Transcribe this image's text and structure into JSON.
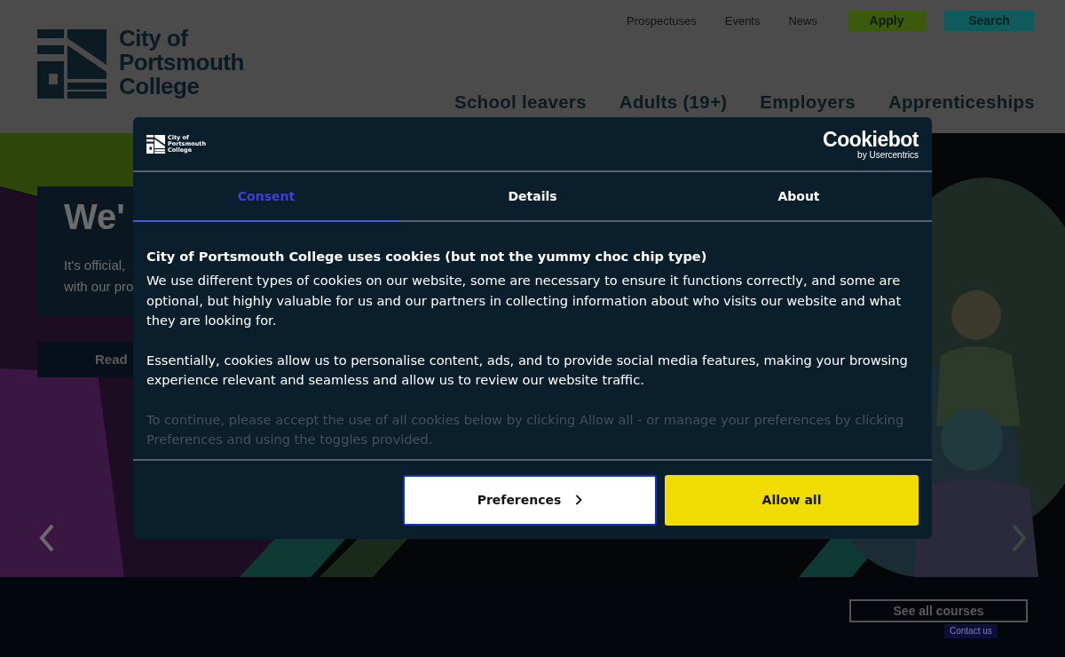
{
  "header": {
    "logo_lines": [
      "City of",
      "Portsmouth",
      "College"
    ],
    "utility_links": [
      {
        "label": "Prospectuses",
        "kind": "link"
      },
      {
        "label": "Events",
        "kind": "link"
      },
      {
        "label": "News",
        "kind": "link"
      },
      {
        "label": "Apply",
        "kind": "apply"
      },
      {
        "label": "Search",
        "kind": "search"
      }
    ],
    "main_nav": [
      "School leavers",
      "Adults (19+)",
      "Employers",
      "Apprenticeships"
    ]
  },
  "hero": {
    "card": {
      "title": "We'",
      "text_lines": [
        "It's official,",
        "with our pro"
      ],
      "button": "Read"
    }
  },
  "courses_band": {
    "button": "See all courses",
    "badge": "Contact us"
  },
  "cookie_dialog": {
    "logo_lines": [
      "City of",
      "Portsmouth",
      "College"
    ],
    "brand": "Cookiebot",
    "brand_sub": "by Usercentrics",
    "tabs": [
      {
        "label": "Consent",
        "selected": true
      },
      {
        "label": "Details",
        "selected": false
      },
      {
        "label": "About",
        "selected": false
      }
    ],
    "heading": "City of Portsmouth College uses cookies (but not the yummy choc chip type)",
    "paragraphs": [
      {
        "text": "We use different types of cookies on our website, some are necessary to ensure it functions correctly, and some are optional, but highly valuable for us and our partners in collecting information about who visits our website and what they are looking for.",
        "faded": false
      },
      {
        "text": "Essentially, cookies allow us to personalise content, ads, and to provide social media features, making your browsing experience relevant and seamless and allow us to review our website traffic.",
        "faded": false
      },
      {
        "text": "To continue, please accept the use of all cookies below by clicking Allow all - or manage your preferences by clicking Preferences and using the toggles provided.",
        "faded": true
      }
    ],
    "buttons": [
      {
        "label": "Preferences",
        "kind": "secondary"
      },
      {
        "label": "Allow all",
        "kind": "primary"
      }
    ]
  }
}
